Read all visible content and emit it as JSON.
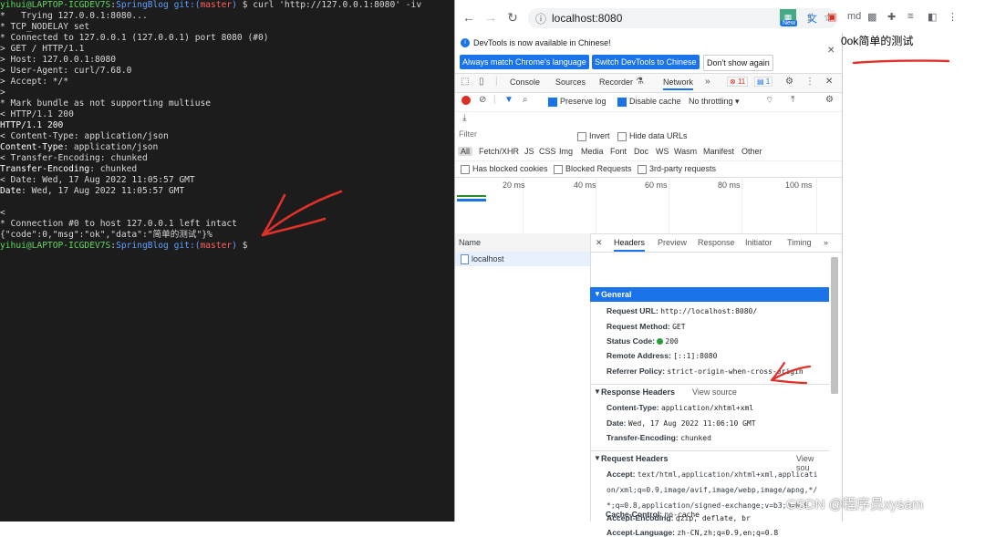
{
  "terminal": {
    "lines": [
      [
        {
          "t": "yihui@LAPTOP-ICGDEV7S",
          "c": "green"
        },
        {
          "t": ":",
          "c": ""
        },
        {
          "t": "SpringBlog",
          "c": "blue"
        },
        {
          "t": " git:(",
          "c": "blue"
        },
        {
          "t": "master",
          "c": "red"
        },
        {
          "t": ")",
          "c": "blue"
        },
        {
          "t": " $ curl 'http://127.0.0.1:8080' -iv",
          "c": ""
        }
      ],
      [
        {
          "t": "*   Trying 127.0.0.1:8080...",
          "c": ""
        }
      ],
      [
        {
          "t": "* TCP_NODELAY set",
          "c": ""
        }
      ],
      [
        {
          "t": "* Connected to 127.0.0.1 (127.0.0.1) port 8080 (#0)",
          "c": ""
        }
      ],
      [
        {
          "t": "> GET / HTTP/1.1",
          "c": ""
        }
      ],
      [
        {
          "t": "> Host: 127.0.0.1:8080",
          "c": ""
        }
      ],
      [
        {
          "t": "> User-Agent: curl/7.68.0",
          "c": ""
        }
      ],
      [
        {
          "t": "> Accept: */*",
          "c": ""
        }
      ],
      [
        {
          "t": ">",
          "c": ""
        }
      ],
      [
        {
          "t": "* Mark bundle as not supporting multiuse",
          "c": ""
        }
      ],
      [
        {
          "t": "< HTTP/1.1 200",
          "c": ""
        }
      ],
      [
        {
          "t": "HTTP/1.1 200",
          "c": "white"
        }
      ],
      [
        {
          "t": "< Content-Type: application/json",
          "c": ""
        }
      ],
      [
        {
          "t": "Content-Type",
          "c": "white"
        },
        {
          "t": ": application/json",
          "c": ""
        }
      ],
      [
        {
          "t": "< Transfer-Encoding: chunked",
          "c": ""
        }
      ],
      [
        {
          "t": "Transfer-Encoding",
          "c": "white"
        },
        {
          "t": ": chunked",
          "c": ""
        }
      ],
      [
        {
          "t": "< Date: Wed, 17 Aug 2022 11:05:57 GMT",
          "c": ""
        }
      ],
      [
        {
          "t": "Date",
          "c": "white"
        },
        {
          "t": ": Wed, 17 Aug 2022 11:05:57 GMT",
          "c": ""
        }
      ],
      [
        {
          "t": "",
          "c": ""
        }
      ],
      [
        {
          "t": "<",
          "c": ""
        }
      ],
      [
        {
          "t": "* Connection #0 to host 127.0.0.1 left intact",
          "c": ""
        }
      ],
      [
        {
          "t": "{\"code\":0,\"msg\":\"ok\",\"data\":\"简单的测试\"}",
          "c": ""
        },
        {
          "t": "%",
          "c": "cursor"
        }
      ],
      [
        {
          "t": "yihui@LAPTOP-ICGDEV7S",
          "c": "green"
        },
        {
          "t": ":",
          "c": ""
        },
        {
          "t": "SpringBlog",
          "c": "blue"
        },
        {
          "t": " git:(",
          "c": "blue"
        },
        {
          "t": "master",
          "c": "red"
        },
        {
          "t": ")",
          "c": "blue"
        },
        {
          "t": " $",
          "c": ""
        }
      ]
    ]
  },
  "browser": {
    "url": "localhost:8080",
    "new_badge": "New",
    "page_text": "0ok简单的测试"
  },
  "devtools": {
    "banner": {
      "text": "DevTools is now available in Chinese!",
      "btn_match": "Always match Chrome's language",
      "btn_switch": "Switch DevTools to Chinese",
      "btn_dont": "Don't show again"
    },
    "tabs": [
      "Console",
      "Sources",
      "Recorder",
      "Network"
    ],
    "error_count": "11",
    "msg_count": "1",
    "toolbar": {
      "preserve_log": "Preserve log",
      "disable_cache": "Disable cache",
      "throttling": "No throttling"
    },
    "filter": {
      "placeholder": "Filter",
      "invert": "Invert",
      "hide_data_urls": "Hide data URLs"
    },
    "types": [
      "All",
      "Fetch/XHR",
      "JS",
      "CSS",
      "Img",
      "Media",
      "Font",
      "Doc",
      "WS",
      "Wasm",
      "Manifest",
      "Other"
    ],
    "blocked": {
      "has_blocked_cookies": "Has blocked cookies",
      "blocked_requests": "Blocked Requests",
      "third_party": "3rd-party requests"
    },
    "timeline_ticks": [
      "20 ms",
      "40 ms",
      "60 ms",
      "80 ms",
      "100 ms"
    ],
    "name_header": "Name",
    "request_name": "localhost",
    "detail_tabs": [
      "Headers",
      "Preview",
      "Response",
      "Initiator",
      "Timing"
    ],
    "general": {
      "title": "General",
      "request_url_k": "Request URL:",
      "request_url_v": "http://localhost:8080/",
      "request_method_k": "Request Method:",
      "request_method_v": "GET",
      "status_code_k": "Status Code:",
      "status_code_v": "200",
      "remote_address_k": "Remote Address:",
      "remote_address_v": "[::1]:8080",
      "referrer_policy_k": "Referrer Policy:",
      "referrer_policy_v": "strict-origin-when-cross-origin"
    },
    "response_headers": {
      "title": "Response Headers",
      "view_source": "View source",
      "content_type_k": "Content-Type:",
      "content_type_v": "application/xhtml+xml",
      "date_k": "Date:",
      "date_v": "Wed, 17 Aug 2022 11:06:10 GMT",
      "transfer_encoding_k": "Transfer-Encoding:",
      "transfer_encoding_v": "chunked"
    },
    "request_headers": {
      "title": "Request Headers",
      "view_source": "View sou",
      "accept_k": "Accept:",
      "accept_v1": "text/html,application/xhtml+xml,applicati",
      "accept_v2": "on/xml;q=0.9,image/avif,image/webp,image/apng,*/",
      "accept_v3": "*;q=0.8,application/signed-exchange;v=b3;q=0.9",
      "accept_encoding_k": "Accept-Encoding:",
      "accept_encoding_v": "gzip, deflate, br",
      "accept_language_k": "Accept-Language:",
      "accept_language_v": "zh-CN,zh;q=0.9,en;q=0.8",
      "cache_control_k": "Cache-Control:",
      "cache_control_v": "no-cache"
    }
  },
  "watermark": "CSDN @程序员xysam",
  "colors": {
    "annotation": "#e0302a",
    "accent": "#1a73e8",
    "terminal_bg": "#1c1c1c"
  }
}
